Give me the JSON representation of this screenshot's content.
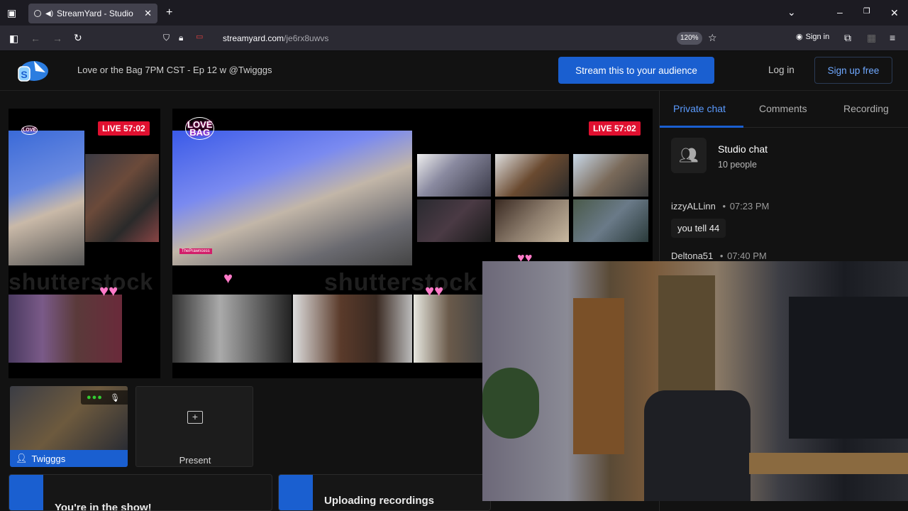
{
  "browser": {
    "tab_title": "StreamYard - Studio",
    "url_host": "streamyard.com",
    "url_path": "/je6rx8uwvs",
    "zoom": "120%",
    "signin": "Sign in"
  },
  "header": {
    "show_title": "Love or the Bag 7PM CST - Ep 12 w @Twigggs",
    "stream_button": "Stream this to your audience",
    "login": "Log in",
    "signup": "Sign up free"
  },
  "stage": {
    "live_badge_left": "LIVE 57:02",
    "live_badge_right": "LIVE 57:02",
    "watermark": "shutterstock",
    "show_logo_line1": "LOVE",
    "show_logo_line2": "BAG"
  },
  "participants": {
    "self_name": "Twigggs",
    "present_label": "Present"
  },
  "notices": {
    "in_show": "You're in the show!",
    "uploading": "Uploading recordings"
  },
  "side": {
    "tabs": [
      "Private chat",
      "Comments",
      "Recording"
    ],
    "studio_chat_title": "Studio chat",
    "studio_chat_people": "10 people",
    "messages": [
      {
        "author": "izzyALLinn",
        "time": "07:23 PM",
        "text": "you tell 44"
      },
      {
        "author": "Deltona51",
        "time": "07:40 PM"
      }
    ]
  },
  "colors": {
    "accent": "#1a5fd0",
    "live": "#e01030"
  }
}
